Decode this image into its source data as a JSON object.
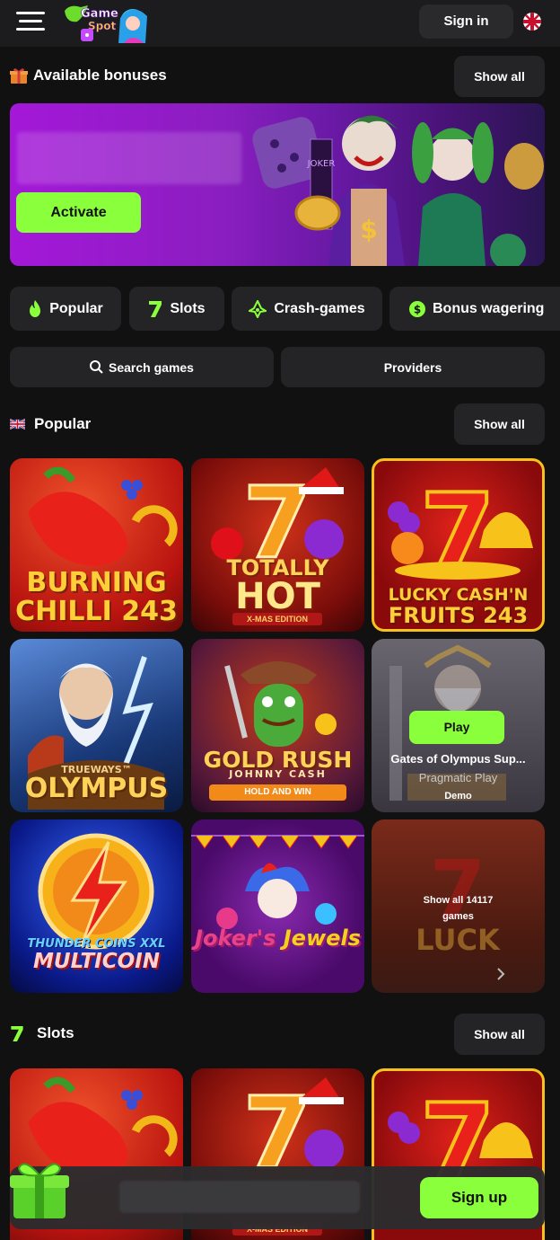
{
  "header": {
    "sign_in": "Sign in"
  },
  "bonuses": {
    "title": "Available bonuses",
    "show_all": "Show all",
    "activate": "Activate"
  },
  "categories": [
    {
      "label": "Popular",
      "icon": "flame-icon"
    },
    {
      "label": "Slots",
      "icon": "seven-icon"
    },
    {
      "label": "Crash-games",
      "icon": "crash-icon"
    },
    {
      "label": "Bonus wagering",
      "icon": "dollar-coin-icon"
    }
  ],
  "tools": {
    "search": "Search games",
    "providers": "Providers"
  },
  "popular": {
    "title": "Popular",
    "show_all": "Show all",
    "games": [
      {
        "line1": "BURNING",
        "line2": "CHILLI 243"
      },
      {
        "line1": "TOTALLY",
        "line2": "HOT",
        "sub": "X-MAS EDITION"
      },
      {
        "line1": "LUCKY CASH'N",
        "line2": "FRUITS 243"
      },
      {
        "line1": "TRUEWAYS™",
        "line2": "OLYMPUS"
      },
      {
        "line1": "GOLD RUSH",
        "line2": "JOHNNY CASH",
        "sub": "HOLD AND WIN"
      },
      {
        "line1": "Gates of Olympus Sup...",
        "provider": "Pragmatic Play",
        "play": "Play",
        "demo": "Demo"
      },
      {
        "line1": "THUNDER COINS XXL",
        "line2": "MULTICOIN"
      },
      {
        "line1": "Joker's",
        "line2": "Jewels"
      },
      {
        "show_all": "Show all 14117 games"
      }
    ]
  },
  "slots": {
    "title": "Slots",
    "show_all": "Show all",
    "games": [
      {
        "sub": "X-MAS EDITION"
      }
    ]
  },
  "bottom": {
    "sign_up": "Sign up"
  },
  "colors": {
    "accent": "#8aff3c",
    "bg": "#111112",
    "panel": "#242426"
  }
}
